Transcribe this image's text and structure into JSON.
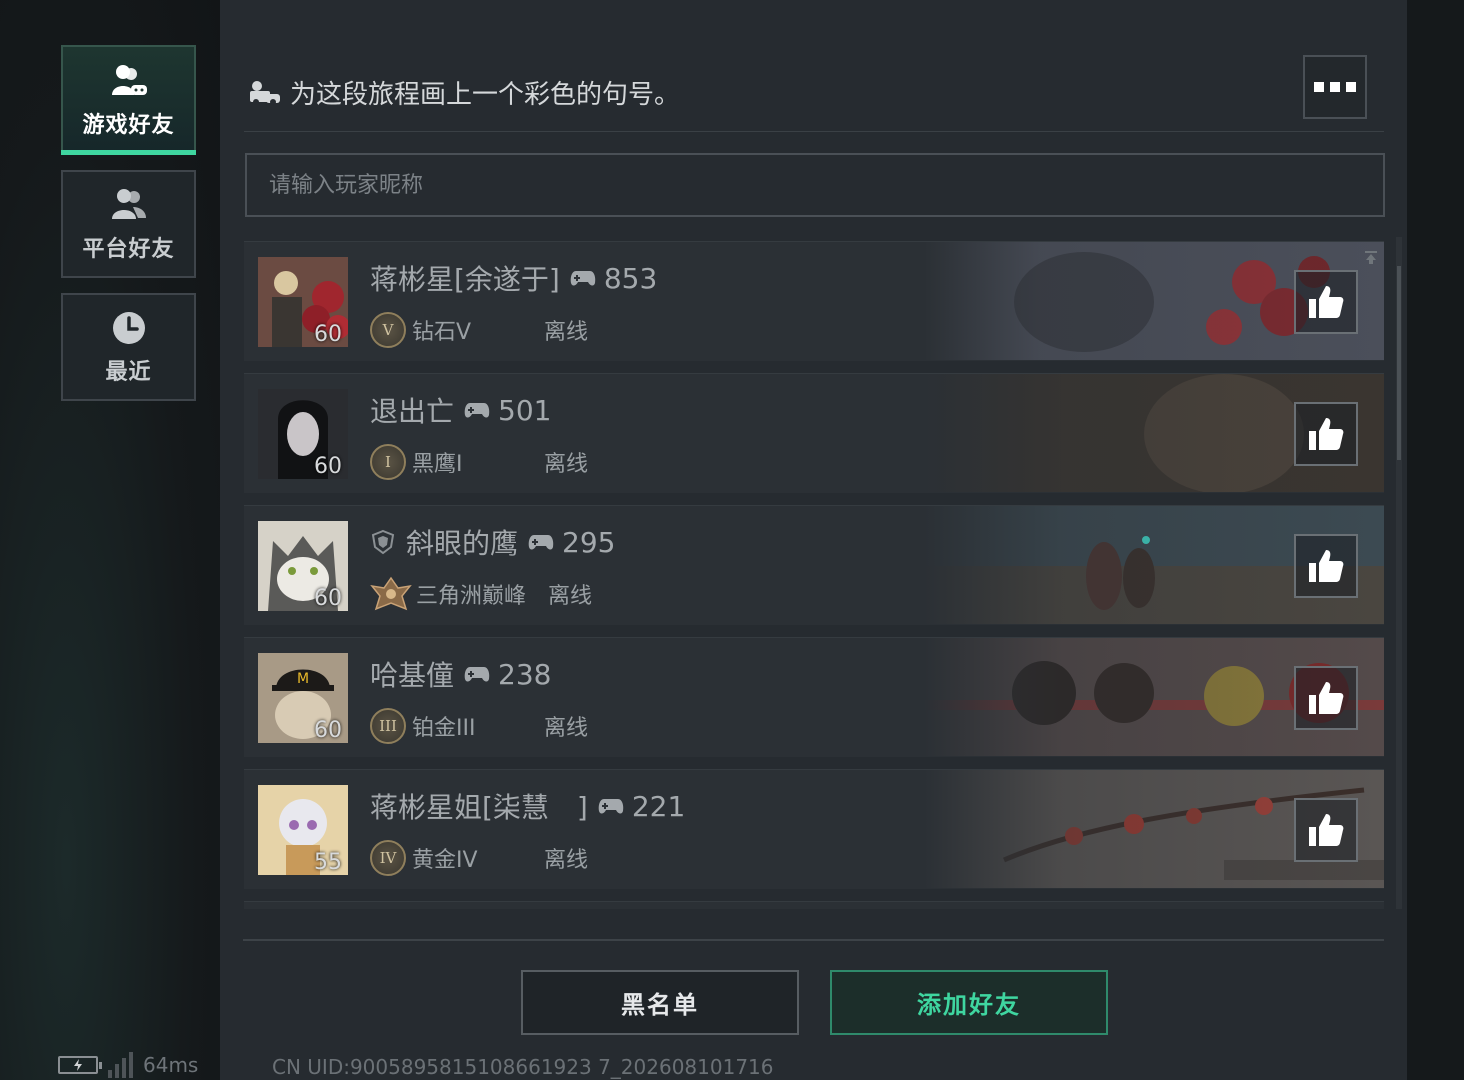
{
  "nav": {
    "items": [
      {
        "label": "游戏好友",
        "icon": "game-friends-icon",
        "active": true
      },
      {
        "label": "平台好友",
        "icon": "platform-friends-icon",
        "active": false
      },
      {
        "label": "最近",
        "icon": "clock-icon",
        "active": false
      }
    ]
  },
  "status": {
    "ping": "64ms"
  },
  "header": {
    "signature": "为这段旅程画上一个彩色的句号。",
    "more_icon": "more-dots-icon"
  },
  "search": {
    "placeholder": "请输入玩家昵称",
    "value": ""
  },
  "friends": [
    {
      "name": "蒋彬星[余遂于]",
      "score": "853",
      "level": "60",
      "rank_badge": "V",
      "rank": "钻石V",
      "status": "离线"
    },
    {
      "name": "退出亡",
      "score": "501",
      "level": "60",
      "rank_badge": "I",
      "rank": "黑鹰I",
      "status": "离线"
    },
    {
      "name": "斜眼的鹰",
      "score": "295",
      "level": "60",
      "rank_badge": "",
      "rank": "三角洲巅峰",
      "status": "离线"
    },
    {
      "name": "哈基僮",
      "score": "238",
      "level": "60",
      "rank_badge": "III",
      "rank": "铂金III",
      "status": "离线"
    },
    {
      "name": "蒋彬星姐[柒慧　]",
      "score": "221",
      "level": "55",
      "rank_badge": "IV",
      "rank": "黄金IV",
      "status": "离线"
    }
  ],
  "buttons": {
    "blacklist": "黑名单",
    "add_friend": "添加好友"
  },
  "footer": {
    "uid": "CN UID:9005895815108661923 7_202608101716"
  },
  "colors": {
    "accent": "#3fd6a0",
    "panel": "#262b30"
  }
}
